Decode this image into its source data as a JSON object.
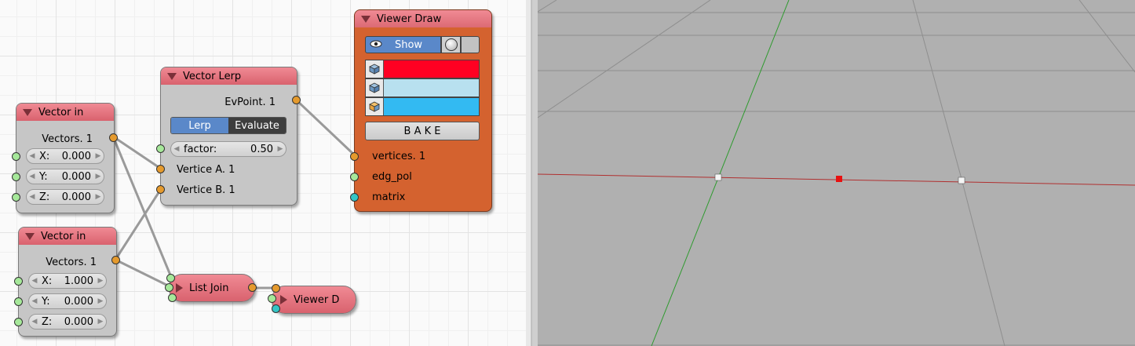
{
  "nodes": {
    "vector_in_1": {
      "title": "Vector in",
      "output": "Vectors. 1",
      "fields": [
        {
          "label": "X:",
          "value": "0.000"
        },
        {
          "label": "Y:",
          "value": "0.000"
        },
        {
          "label": "Z:",
          "value": "0.000"
        }
      ]
    },
    "vector_in_2": {
      "title": "Vector in",
      "output": "Vectors. 1",
      "fields": [
        {
          "label": "X:",
          "value": "1.000"
        },
        {
          "label": "Y:",
          "value": "0.000"
        },
        {
          "label": "Z:",
          "value": "0.000"
        }
      ]
    },
    "vector_lerp": {
      "title": "Vector Lerp",
      "output": "EvPoint. 1",
      "mode_options": [
        "Lerp",
        "Evaluate"
      ],
      "mode_selected": "Lerp",
      "factor_label": "factor:",
      "factor_value": "0.50",
      "inputs": [
        "Vertice A. 1",
        "Vertice B. 1"
      ]
    },
    "viewer_draw": {
      "title": "Viewer Draw",
      "show_label": "Show",
      "colors": [
        "#ff0022",
        "#b8e0ef",
        "#33baf2"
      ],
      "bake_label": "B A K E",
      "inputs": [
        "vertices. 1",
        "edg_pol",
        "matrix"
      ]
    },
    "list_join": {
      "title": "List Join"
    },
    "viewer_d": {
      "title": "Viewer D"
    }
  },
  "socket_colors": {
    "vertices": "#e59a2d",
    "generic": "#a6e89a",
    "matrix": "#35c5c5"
  },
  "viewport": {
    "background": "#b0b0b0",
    "x_axis_color": "#b03030",
    "y_axis_color": "#2e9a2e",
    "selected_vertex_color": "#e81010"
  }
}
